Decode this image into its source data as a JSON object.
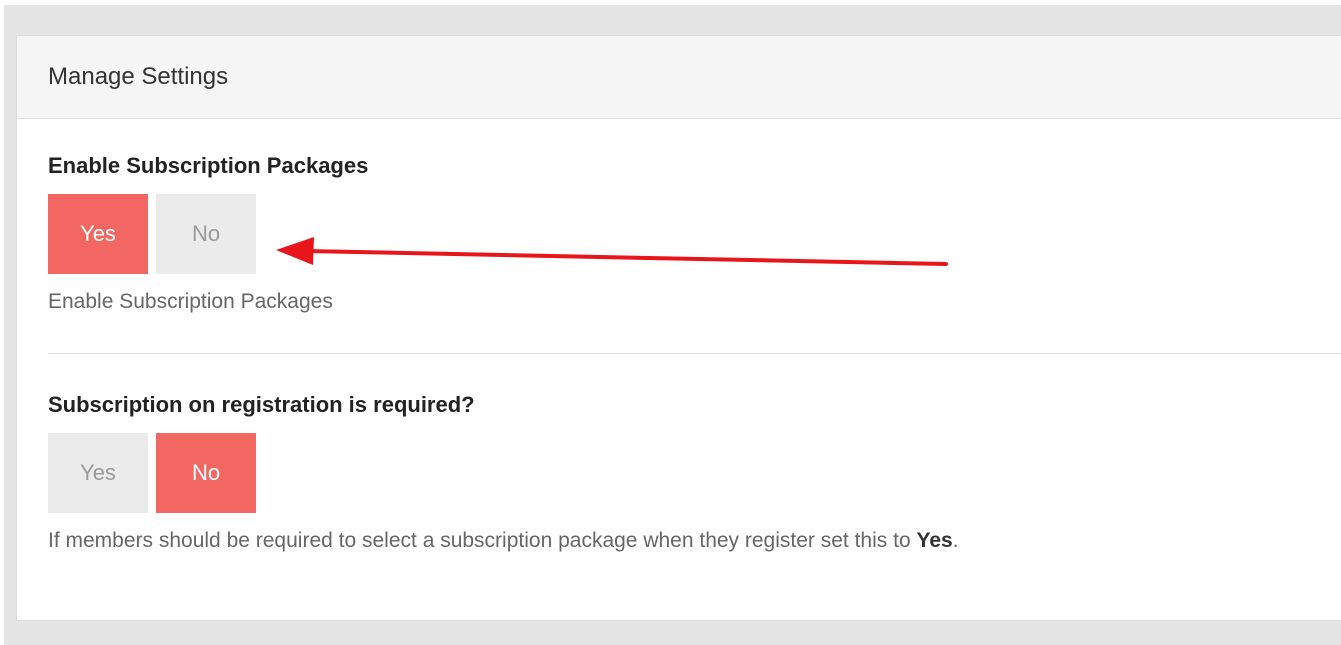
{
  "panel": {
    "title": "Manage Settings"
  },
  "settings": [
    {
      "label": "Enable Subscription Packages",
      "options": [
        "Yes",
        "No"
      ],
      "selected": "Yes",
      "help": "Enable Subscription Packages"
    },
    {
      "label": "Subscription on registration is required?",
      "options": [
        "Yes",
        "No"
      ],
      "selected": "No",
      "help_prefix": "If members should be required to select a subscription package when they register set this to ",
      "help_emphasis": "Yes",
      "help_suffix": "."
    }
  ],
  "colors": {
    "active": "#f26762",
    "inactive": "#ebebeb",
    "annotation_arrow": "#e8161b"
  },
  "annotation": {
    "icon": "red-arrow-icon"
  }
}
